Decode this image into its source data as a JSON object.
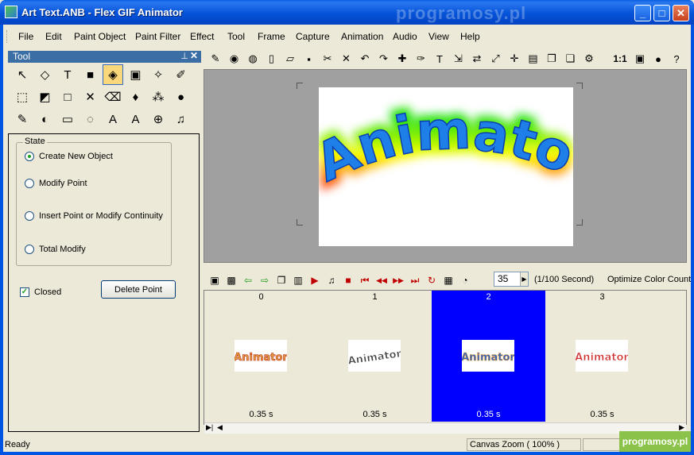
{
  "window": {
    "title": "Art Text.ANB - Flex GIF Animator",
    "watermark_top": "programosy.pl",
    "minimize_label": "_",
    "maximize_label": "□",
    "close_label": "✕"
  },
  "menu": [
    {
      "label": "File"
    },
    {
      "label": "Edit"
    },
    {
      "label": "Paint Object"
    },
    {
      "label": "Paint Filter"
    },
    {
      "label": "Effect"
    },
    {
      "label": "Tool"
    },
    {
      "label": "Frame"
    },
    {
      "label": "Capture"
    },
    {
      "label": "Animation"
    },
    {
      "label": "Audio"
    },
    {
      "label": "View"
    },
    {
      "label": "Help"
    }
  ],
  "tool_panel": {
    "title": "Tool",
    "pin": "⊥",
    "close": "✕",
    "tools": [
      {
        "icon": "arrow-pointer-icon",
        "glyph": "↖"
      },
      {
        "icon": "node-select-icon",
        "glyph": "◇"
      },
      {
        "icon": "text-tool-icon",
        "glyph": "T"
      },
      {
        "icon": "rectangle-fill-icon",
        "glyph": "■"
      },
      {
        "icon": "art-path-icon",
        "glyph": "◈",
        "selected": true
      },
      {
        "icon": "image-icon",
        "glyph": "▣"
      },
      {
        "icon": "magic-wand-icon",
        "glyph": "✧"
      },
      {
        "icon": "brush-icon",
        "glyph": "✐"
      },
      {
        "icon": "marquee-select-icon",
        "glyph": "⬚"
      },
      {
        "icon": "crop-icon",
        "glyph": "◩"
      },
      {
        "icon": "rectangle-outline-icon",
        "glyph": "□"
      },
      {
        "icon": "transform-icon",
        "glyph": "✕"
      },
      {
        "icon": "eraser-icon",
        "glyph": "⌫"
      },
      {
        "icon": "fill-bucket-icon",
        "glyph": "♦"
      },
      {
        "icon": "spray-icon",
        "glyph": "⁂"
      },
      {
        "icon": "drop-icon",
        "glyph": "●"
      },
      {
        "icon": "eyedropper-icon",
        "glyph": "✎"
      },
      {
        "icon": "color-swatch-icon",
        "glyph": "◐"
      },
      {
        "icon": "frame-rect-icon",
        "glyph": "▭"
      },
      {
        "icon": "blur-icon",
        "glyph": "◌"
      },
      {
        "icon": "art-text-icon",
        "glyph": "A"
      },
      {
        "icon": "outline-text-icon",
        "glyph": "A"
      },
      {
        "icon": "zoom-icon",
        "glyph": "⊕"
      },
      {
        "icon": "music-note-icon",
        "glyph": "♫"
      }
    ]
  },
  "properties": {
    "state_legend": "State",
    "options": [
      {
        "label": "Create New Object",
        "checked": true
      },
      {
        "label": "Modify Point",
        "checked": false
      },
      {
        "label": "Insert Point or Modify Continuity",
        "checked": false
      },
      {
        "label": "Total Modify",
        "checked": false
      }
    ],
    "closed_label": "Closed",
    "closed_checked": true,
    "delete_point_label": "Delete Point"
  },
  "main_toolbar": {
    "zoom_label": "1:1",
    "icons": [
      "pencil-icon",
      "eye-icon",
      "globe-icon",
      "new-file-icon",
      "open-folder-icon",
      "save-icon",
      "cut-icon",
      "delete-icon",
      "undo-icon",
      "redo-icon",
      "pen-add-icon",
      "pen-remove-icon",
      "text-icon",
      "resize-icon",
      "flip-icon",
      "scale-icon",
      "center-icon",
      "align-icon",
      "copy-frame-icon",
      "paste-frame-icon",
      "settings-tool-icon",
      "fit-icon",
      "circle-icon",
      "help-icon"
    ]
  },
  "canvas": {
    "art_text": "Animator"
  },
  "animation_toolbar": {
    "delay_value": "35",
    "delay_unit": "(1/100 Second)",
    "optimize_label": "Optimize Color Count",
    "icons": [
      "frame-add-icon",
      "frame-image-icon",
      "prev-arrow-icon",
      "next-arrow-icon",
      "duplicate-frame-icon",
      "trash-icon",
      "play-icon",
      "sound-icon",
      "stop-icon",
      "first-frame-icon",
      "rewind-icon",
      "fast-forward-icon",
      "last-frame-icon",
      "loop-icon",
      "palette-icon",
      "timer-icon"
    ]
  },
  "frames": [
    {
      "number": "0",
      "duration": "0.35 s",
      "selected": false,
      "thumb_text": "Animator"
    },
    {
      "number": "1",
      "duration": "0.35 s",
      "selected": false,
      "thumb_text": "Animator"
    },
    {
      "number": "2",
      "duration": "0.35 s",
      "selected": true,
      "thumb_text": "Animator"
    },
    {
      "number": "3",
      "duration": "0.35 s",
      "selected": false,
      "thumb_text": "Animator"
    }
  ],
  "status": {
    "ready": "Ready",
    "zoom": "Canvas Zoom ( 100% )",
    "watermark": "programosy.pl"
  },
  "colors": {
    "title_blue": "#0054e3",
    "selected_frame": "#0000ff",
    "canvas_gray": "#a0a0a0",
    "panel_title": "#3a6ea5"
  }
}
